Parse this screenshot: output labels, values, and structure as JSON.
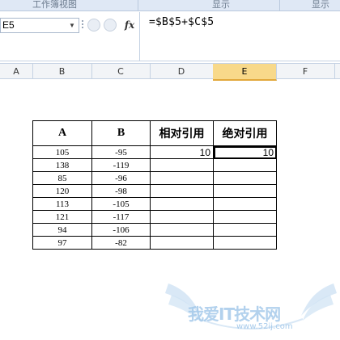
{
  "ribbon": {
    "groups": [
      "工作簿视图",
      "显示",
      "显示"
    ]
  },
  "formula_bar": {
    "name_box": "E5",
    "fx_label": "fx",
    "formula": "=$B$5+$C$5"
  },
  "columns": [
    "A",
    "B",
    "C",
    "D",
    "E",
    "F"
  ],
  "selected_column": "E",
  "table": {
    "headers": [
      "A",
      "B",
      "相对引用",
      "绝对引用"
    ],
    "rows": [
      [
        "105",
        "-95",
        "10",
        "10"
      ],
      [
        "138",
        "-119",
        "",
        ""
      ],
      [
        "85",
        "-96",
        "",
        ""
      ],
      [
        "120",
        "-98",
        "",
        ""
      ],
      [
        "113",
        "-105",
        "",
        ""
      ],
      [
        "121",
        "-117",
        "",
        ""
      ],
      [
        "94",
        "-106",
        "",
        ""
      ],
      [
        "97",
        "-82",
        "",
        ""
      ]
    ]
  },
  "watermark": {
    "text": "我爱IT技术网",
    "url": "www.52ij.com"
  },
  "colors": {
    "accent_selected_column": "#f8d98a",
    "grid_line": "#c5d2e3",
    "watermark": "#9fc6e9"
  }
}
